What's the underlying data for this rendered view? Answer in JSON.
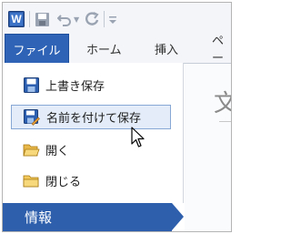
{
  "qat": {
    "app_icon_letter": "W",
    "icons": [
      "word-icon",
      "save-icon",
      "undo-icon",
      "redo-icon",
      "customize-icon"
    ]
  },
  "ribbon": {
    "tabs": [
      {
        "label": "ファイル"
      },
      {
        "label": "ホーム"
      },
      {
        "label": "挿入"
      },
      {
        "label": "ペー"
      }
    ]
  },
  "backstage": {
    "menu": [
      {
        "label": "上書き保存",
        "icon": "save-icon"
      },
      {
        "label": "名前を付けて保存",
        "icon": "save-as-icon",
        "selected": true
      },
      {
        "label": "開く",
        "icon": "open-folder-icon"
      },
      {
        "label": "閉じる",
        "icon": "close-folder-icon"
      }
    ],
    "info_label": "情報"
  },
  "document": {
    "partial_char": "文"
  },
  "colors": {
    "file_tab": "#2e63b6",
    "info_bar": "#2e5fad",
    "selected_bg": "#e3ecf8",
    "selected_border": "#87a8d4"
  }
}
